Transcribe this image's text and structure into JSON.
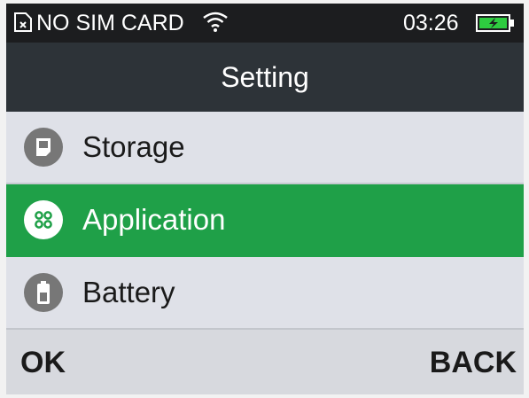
{
  "status_bar": {
    "sim_icon": "no-sim-icon",
    "carrier": "NO SIM CARD",
    "wifi_icon": "wifi-icon",
    "time": "03:26",
    "battery_icon": "battery-charging-icon"
  },
  "header": {
    "title": "Setting"
  },
  "menu": {
    "items": [
      {
        "label": "Storage",
        "icon": "storage-icon",
        "selected": false
      },
      {
        "label": "Application",
        "icon": "application-icon",
        "selected": true
      },
      {
        "label": "Battery",
        "icon": "battery-icon",
        "selected": false
      }
    ]
  },
  "softkeys": {
    "left": "OK",
    "right": "BACK"
  },
  "colors": {
    "status_bar_bg": "#1c1d1f",
    "title_bar_bg": "#2d3338",
    "list_bg": "#dfe1e8",
    "selected_bg": "#1fa048",
    "icon_bg": "#777777",
    "battery_fill": "#2ecc40"
  }
}
